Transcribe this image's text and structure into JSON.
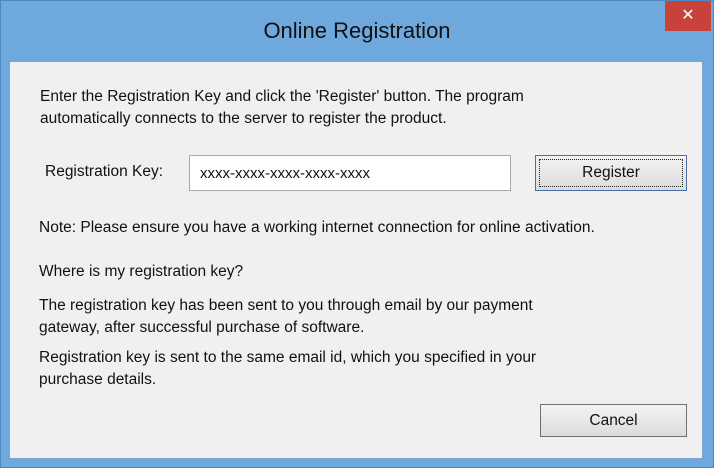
{
  "window": {
    "title": "Online Registration",
    "close_symbol": "✕"
  },
  "intro": {
    "line1": "Enter the Registration Key and click the 'Register' button. The program",
    "line2": "automatically connects to the server to register the product."
  },
  "key_field": {
    "label": "Registration Key:",
    "value": "xxxx-xxxx-xxxx-xxxx-xxxx"
  },
  "buttons": {
    "register_label": "Register",
    "cancel_label": "Cancel"
  },
  "note": "Note: Please ensure you have a working internet connection for online activation.",
  "help": {
    "question": "Where is my registration key?",
    "para1_line1": "The registration key has been sent to you through email by our payment",
    "para1_line2": "gateway, after successful purchase of software.",
    "para2_line1": "Registration key is sent to the same email id, which you specified in your",
    "para2_line2": "purchase details."
  },
  "colors": {
    "titlebar": "#6ea8dc",
    "close_button": "#c7433a",
    "dialog_background": "#f0f0f0"
  },
  "icons": {
    "close": "close-icon"
  }
}
